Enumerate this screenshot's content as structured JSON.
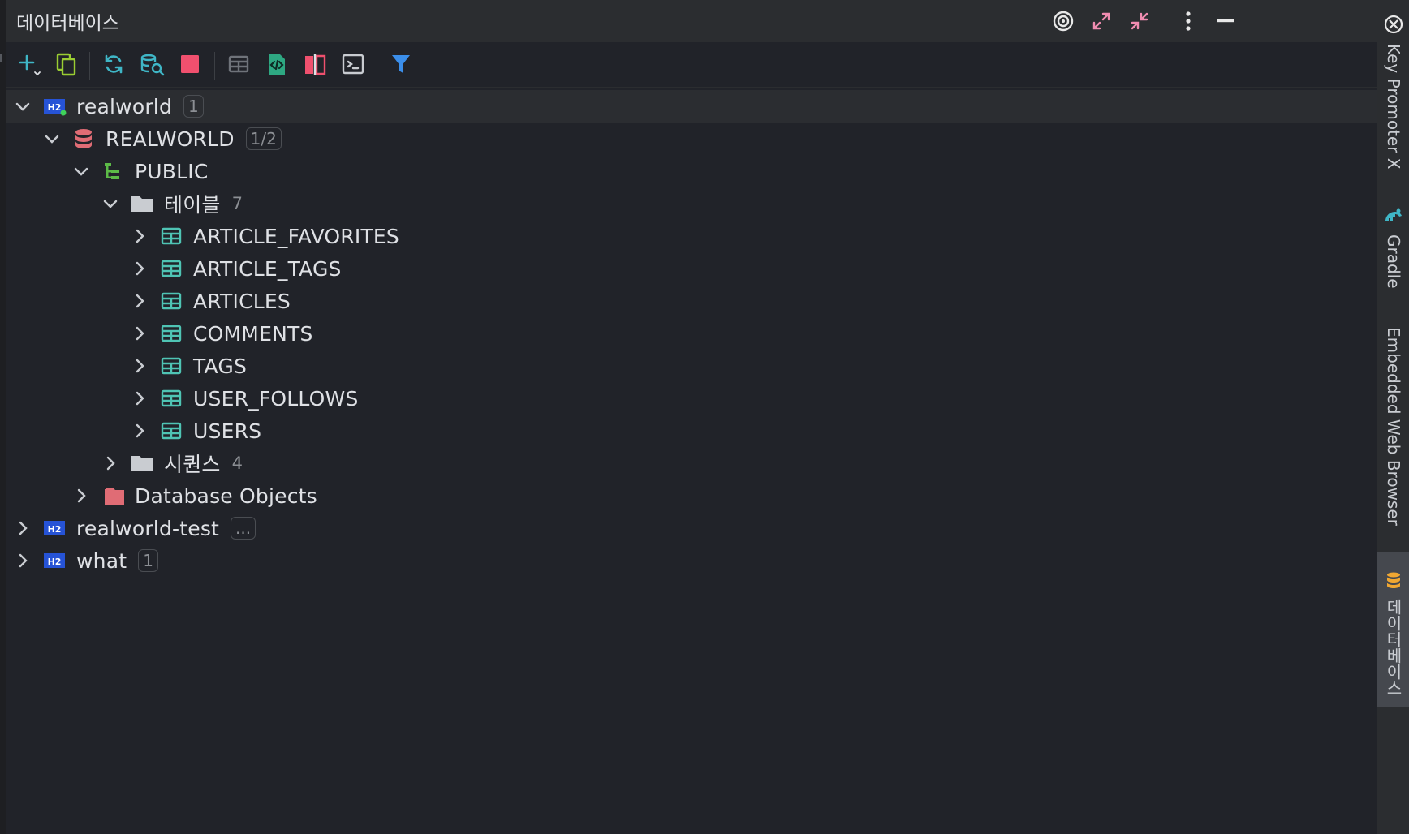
{
  "header": {
    "title": "데이터베이스",
    "buttons": [
      "target-icon",
      "expand-icon",
      "collapse-icon",
      "more-vertical-icon",
      "minimize-icon"
    ]
  },
  "toolbar": {
    "buttons": [
      "add-icon",
      "duplicate-icon",
      "refresh-icon",
      "schema-search-icon",
      "stop-icon",
      "table-view-icon",
      "ddl-file-icon",
      "compare-icon",
      "console-icon",
      "filter-icon"
    ]
  },
  "tree": {
    "realworld": {
      "label": "realworld",
      "badge": "1"
    },
    "realworld_schema": {
      "label": "REALWORLD",
      "badge": "1/2"
    },
    "public": {
      "label": "PUBLIC"
    },
    "tables_folder": {
      "label": "테이블",
      "count": "7"
    },
    "tables": [
      "ARTICLE_FAVORITES",
      "ARTICLE_TAGS",
      "ARTICLES",
      "COMMENTS",
      "TAGS",
      "USER_FOLLOWS",
      "USERS"
    ],
    "sequences_folder": {
      "label": "시퀀스",
      "count": "4"
    },
    "db_objects": {
      "label": "Database Objects"
    },
    "realworld_test": {
      "label": "realworld-test",
      "badge": "..."
    },
    "what": {
      "label": "what",
      "badge": "1"
    }
  },
  "right_bar": {
    "tabs": [
      {
        "label": "Key Promoter X",
        "icon": "key-promoter-icon"
      },
      {
        "label": "Gradle",
        "icon": "gradle-elephant-icon"
      },
      {
        "label": "Embedded Web Browser",
        "icon": ""
      },
      {
        "label": "데이터베이스",
        "icon": "database-icon"
      }
    ]
  },
  "colors": {
    "background": "#212329",
    "header": "#2b2d30",
    "table_icon": "#4fc4b4",
    "h2_badge": "#2653d6",
    "schema_icon": "#e06c75",
    "filter_icon": "#3b8eea"
  }
}
